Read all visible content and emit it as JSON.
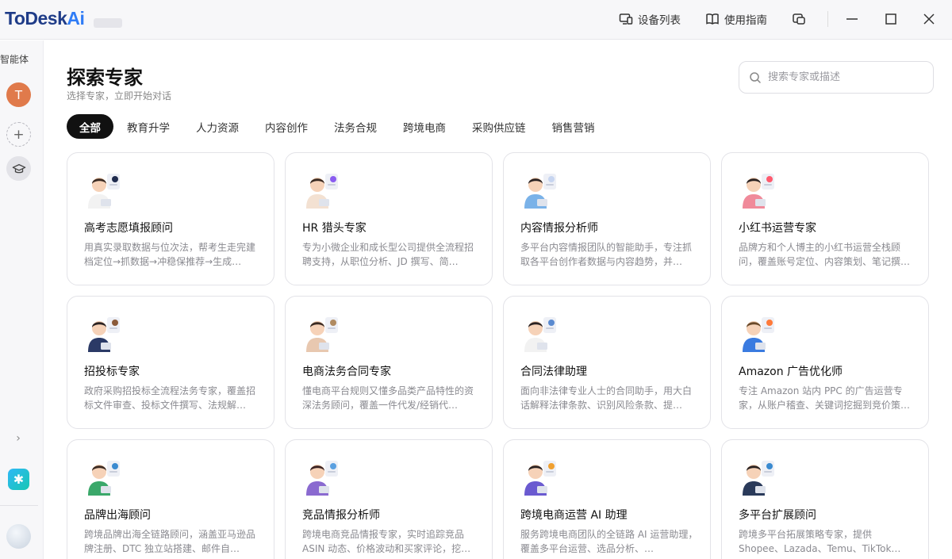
{
  "app": {
    "brand_main": "ToDesk",
    "brand_accent": "Ai"
  },
  "titlebar": {
    "device_list": "设备列表",
    "user_guide": "使用指南"
  },
  "sidebar": {
    "label": "智能体",
    "avatar_letter": "T",
    "add_symbol": "+",
    "expand_symbol": "›",
    "app_symbol": "✱"
  },
  "page": {
    "title": "探索专家",
    "subtitle": "选择专家，立即开始对话",
    "search_placeholder": "搜索专家或描述"
  },
  "tabs": [
    "全部",
    "教育升学",
    "人力资源",
    "内容创作",
    "法务合规",
    "跨境电商",
    "采购供应链",
    "销售营销"
  ],
  "active_tab": 0,
  "experts": [
    {
      "name": "高考志愿填报顾问",
      "desc": "用真实录取数据与位次法，帮考生走完建档定位→抓数据→冲稳保推荐→生成…",
      "shirt": "#f2f2f2",
      "hair": "#3a2a22",
      "prop": "#1f2b4d"
    },
    {
      "name": "HR 猎头专家",
      "desc": "专为小微企业和成长型公司提供全流程招聘支持，从职位分析、JD 撰写、简…",
      "shirt": "#f3e1d2",
      "hair": "#3a2a22",
      "prop": "#8a5cf0"
    },
    {
      "name": "内容情报分析师",
      "desc": "多平台内容情报团队的智能助手，专注抓取各平台创作者数据与内容趋势，并…",
      "shirt": "#7ab2e8",
      "hair": "#2a2222",
      "prop": "#c7d5f0"
    },
    {
      "name": "小红书运营专家",
      "desc": "品牌方和个人博主的小红书运营全栈顾问，覆盖账号定位、内容策划、笔记撰…",
      "shirt": "#f08a9a",
      "hair": "#2a2222",
      "prop": "#ff5a6e"
    },
    {
      "name": "招投标专家",
      "desc": "政府采购招投标全流程法务专家，覆盖招标文件审查、投标文件撰写、法规解…",
      "shirt": "#2b3a66",
      "hair": "#2a2222",
      "prop": "#8a5a3a"
    },
    {
      "name": "电商法务合同专家",
      "desc": "懂电商平台规则又懂多品类产品特性的资深法务顾问，覆盖一件代发/经销代…",
      "shirt": "#e8c8b0",
      "hair": "#3a2a22",
      "prop": "#b08a60"
    },
    {
      "name": "合同法律助理",
      "desc": "面向非法律专业人士的合同助手，用大白话解释法律条款、识别风险条款、提…",
      "shirt": "#f2f2f2",
      "hair": "#2a2222",
      "prop": "#5a8ad0"
    },
    {
      "name": "Amazon 广告优化师",
      "desc": "专注 Amazon 站内 PPC 的广告运营专家，从账户稽查、关键词挖掘到竞价策…",
      "shirt": "#3a7be0",
      "hair": "#6a4a2a",
      "prop": "#ff7a3a"
    },
    {
      "name": "品牌出海顾问",
      "desc": "跨境品牌出海全链路顾问，涵盖亚马逊品牌注册、DTC 独立站搭建、邮件自…",
      "shirt": "#3aa86a",
      "hair": "#3a2a22",
      "prop": "#3a8ad0"
    },
    {
      "name": "竞品情报分析师",
      "desc": "跨境电商竞品情报专家，实时追踪竞品 ASIN 动态、价格波动和买家评论，挖…",
      "shirt": "#8a6ad0",
      "hair": "#3a2222",
      "prop": "#5aa0e0"
    },
    {
      "name": "跨境电商运营 AI 助理",
      "desc": "服务跨境电商团队的全链路 AI 运营助理，覆盖多平台运营、选品分析、…",
      "shirt": "#6a5ad0",
      "hair": "#2a2222",
      "prop": "#f0a030"
    },
    {
      "name": "多平台扩展顾问",
      "desc": "跨境多平台拓展策略专家，提供 Shopee、Lazada、Temu、TikTok…",
      "shirt": "#2a3a5a",
      "hair": "#2a2222",
      "prop": "#3a8ad0"
    }
  ]
}
